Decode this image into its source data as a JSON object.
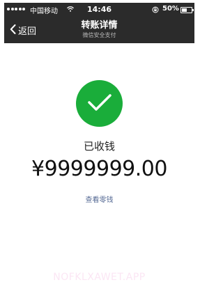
{
  "status_bar": {
    "carrier": "中国移动",
    "time": "14:46",
    "battery_percent": "50%",
    "battery_level": 0.5,
    "icons": [
      "signal-dots-icon",
      "wifi-icon",
      "orientation-lock-icon",
      "battery-icon"
    ]
  },
  "nav": {
    "back_label": "返回",
    "title": "转账详情",
    "subtitle": "微信安全支付",
    "back_icon": "chevron-left-icon"
  },
  "transfer": {
    "status_icon": "checkmark-icon",
    "status": "已收钱",
    "amount": "¥9999999.00",
    "view_change_link": "查看零钱"
  },
  "watermark": "NOFKLXAWET.APP",
  "colors": {
    "bar_background": "#2b2b2b",
    "success_green": "#1aad3a",
    "link_blue": "#576b95",
    "watermark_pink": "#fbe6f4"
  }
}
